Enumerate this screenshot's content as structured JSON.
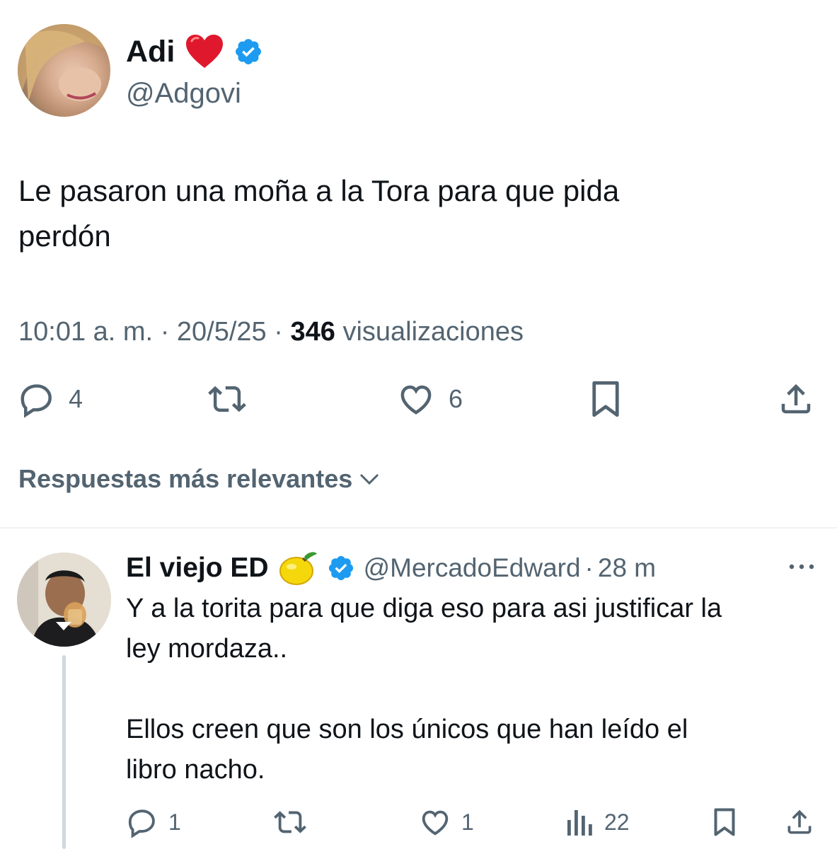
{
  "main_tweet": {
    "author_name": "Adi",
    "author_handle": "@Adgovi",
    "text_line1": "Le pasaron una moña a la Tora para que pida",
    "text_line2": "perdón",
    "time": "10:01 a. m.",
    "date": "20/5/25",
    "separator": "·",
    "views_count": "346",
    "views_label": "visualizaciones",
    "replies": "4",
    "likes": "6"
  },
  "sort_label": "Respuestas más relevantes",
  "reply": {
    "author_name": "El viejo ED",
    "author_handle": "@MercadoEdward",
    "separator": "·",
    "time_ago": "28 m",
    "line1": "Y a la torita para que diga eso para asi justificar la",
    "line2": "ley mordaza..",
    "line3": "Ellos creen que son los únicos que han leído el",
    "line4": "libro nacho.",
    "replies": "1",
    "likes": "1",
    "views": "22"
  },
  "colors": {
    "verified": "#1d9bf0",
    "heart_emoji": "#e0182d",
    "secondary_text": "#536471",
    "divider": "#eff3f4"
  },
  "icons": [
    "heart-emoji-icon",
    "verified-badge-icon",
    "lemon-emoji-icon",
    "reply-icon",
    "retweet-icon",
    "like-icon",
    "bookmark-icon",
    "share-icon",
    "views-icon",
    "more-icon",
    "chevron-down-icon"
  ]
}
